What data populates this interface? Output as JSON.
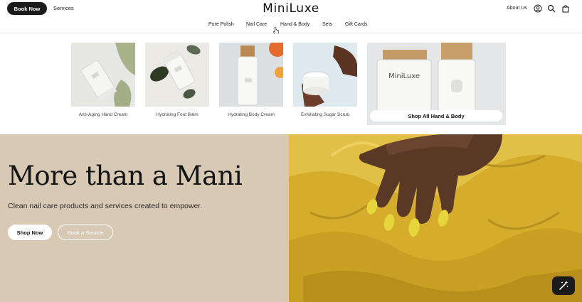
{
  "header": {
    "book_label": "Book Now",
    "services_label": "Services",
    "logo": "MiniLuxe",
    "about_label": "About Us",
    "icons": [
      "account-icon",
      "search-icon",
      "bag-icon"
    ]
  },
  "nav": {
    "items": [
      "Pure Polish",
      "Nail Care",
      "Hand & Body",
      "Sets",
      "Gift Cards"
    ]
  },
  "dropdown": {
    "products": [
      {
        "label": "Anti-Aging Hand Cream"
      },
      {
        "label": "Hydrating Foot Balm"
      },
      {
        "label": "Hydrating Body Cream"
      },
      {
        "label": "Exfoliating Sugar Scrub"
      }
    ],
    "shop_all_label": "Shop All Hand & Body",
    "product_brand_text": "MiniLuxe"
  },
  "hero": {
    "title": "More than a Mani",
    "subtitle": "Clean nail care products and services created to empower.",
    "shop_label": "Shop Now",
    "service_label": "Book a Service"
  },
  "colors": {
    "accent_dark": "#1b1b1b",
    "hero_beige": "#d8c9b5",
    "hero_yellow": "#d9b12f"
  }
}
